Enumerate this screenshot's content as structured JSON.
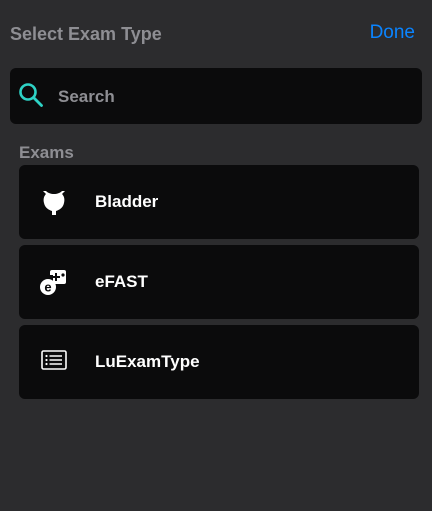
{
  "header": {
    "title": "Select Exam Type",
    "done_label": "Done"
  },
  "search": {
    "placeholder": "Search",
    "value": "",
    "icon": "search-icon"
  },
  "section": {
    "label": "Exams"
  },
  "exams": [
    {
      "label": "Bladder",
      "icon": "bladder-icon"
    },
    {
      "label": "eFAST",
      "icon": "efast-icon"
    },
    {
      "label": "LuExamType",
      "icon": "list-icon"
    }
  ],
  "colors": {
    "background": "#2c2c2e",
    "card": "#0b0b0c",
    "accent": "#0a84ff",
    "search_icon": "#2ed3c6",
    "muted_text": "#8e8e93",
    "text": "#ffffff"
  }
}
